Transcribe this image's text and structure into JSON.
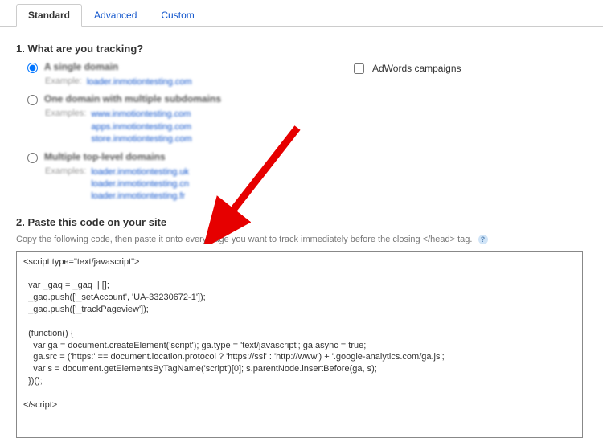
{
  "tabs": {
    "standard": "Standard",
    "advanced": "Advanced",
    "custom": "Custom"
  },
  "section1": {
    "title": "1. What are you tracking?",
    "opt1": {
      "label": "A single domain",
      "example_key": "Example:",
      "example_val": "loader.inmotiontesting.com"
    },
    "opt2": {
      "label": "One domain with multiple subdomains",
      "example_key": "Examples:",
      "example_val": "www.inmotiontesting.com\napps.inmotiontesting.com\nstore.inmotiontesting.com"
    },
    "opt3": {
      "label": "Multiple top-level domains",
      "example_key": "Examples:",
      "example_val": "loader.inmotiontesting.uk\nloader.inmotiontesting.cn\nloader.inmotiontesting.fr"
    },
    "adwords": "AdWords campaigns"
  },
  "section2": {
    "title": "2. Paste this code on your site",
    "instruction": "Copy the following code, then paste it onto every page you want to track immediately before the closing </head> tag.",
    "code": "<script type=\"text/javascript\">\n\n  var _gaq = _gaq || [];\n  _gaq.push(['_setAccount', 'UA-33230672-1']);\n  _gaq.push(['_trackPageview']);\n\n  (function() {\n    var ga = document.createElement('script'); ga.type = 'text/javascript'; ga.async = true;\n    ga.src = ('https:' == document.location.protocol ? 'https://ssl' : 'http://www') + '.google-analytics.com/ga.js';\n    var s = document.getElementsByTagName('script')[0]; s.parentNode.insertBefore(ga, s);\n  })();\n\n</scr"
  },
  "code_suffix": "ipt>"
}
